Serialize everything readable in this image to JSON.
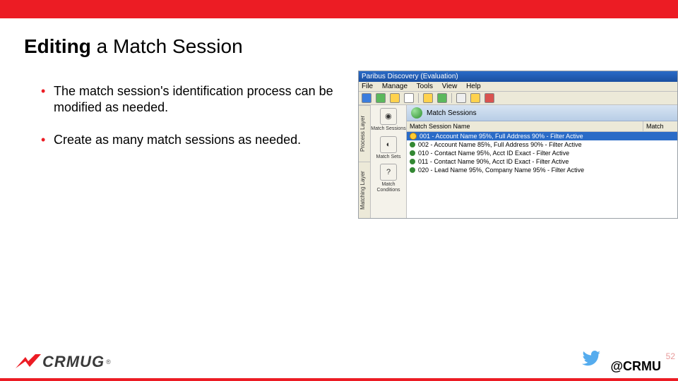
{
  "title": {
    "strong": "Editing",
    "rest": " a Match Session"
  },
  "bullets": [
    "The match session's identification process can be modified as needed.",
    "Create as many match sessions as needed."
  ],
  "screenshot": {
    "window_title": "Paribus Discovery (Evaluation)",
    "menu": [
      "File",
      "Manage",
      "Tools",
      "View",
      "Help"
    ],
    "layer_tabs": [
      "Process Layer",
      "Matching Layer"
    ],
    "nav": [
      {
        "label": "Match Sessions",
        "glyph": "◉"
      },
      {
        "label": "Match Sets",
        "glyph": "◐"
      },
      {
        "label": "Match Conditions",
        "glyph": "?"
      }
    ],
    "pane_title": "Match Sessions",
    "col1": "Match Session Name",
    "col2": "Match",
    "rows": [
      {
        "name": "001 - Account Name 95%, Full Address 90% - Filter Active",
        "sel": true
      },
      {
        "name": "002 - Account Name 85%, Full Address 90% - Filter Active",
        "sel": false
      },
      {
        "name": "010 - Contact Name 95%, Acct ID Exact - Filter Active",
        "sel": false
      },
      {
        "name": "011 - Contact Name 90%, Acct ID Exact - Filter Active",
        "sel": false
      },
      {
        "name": "020 - Lead Name 95%, Company Name 95% - Filter Active",
        "sel": false
      }
    ]
  },
  "footer": {
    "brand": "CRMUG",
    "handle": "@CRMU",
    "page": "52"
  }
}
